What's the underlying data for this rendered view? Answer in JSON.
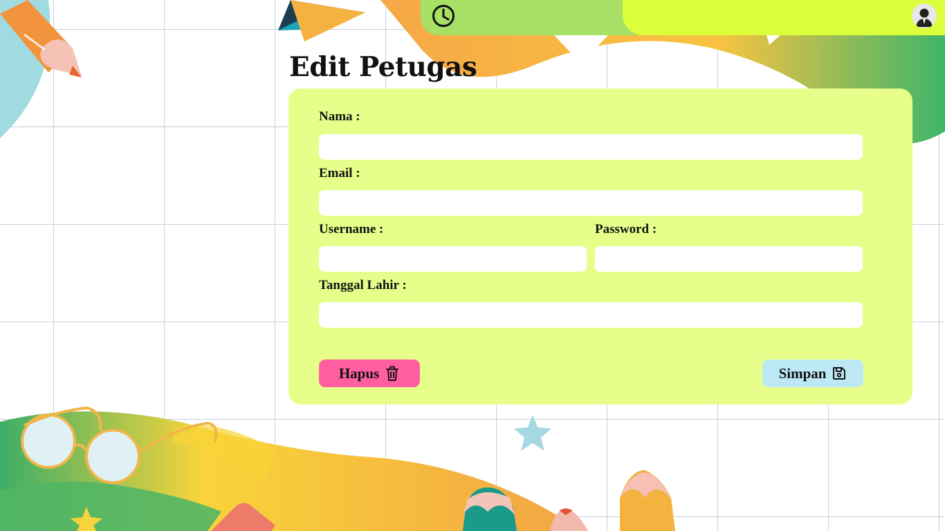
{
  "page": {
    "title": "Edit Petugas"
  },
  "topbar": {
    "clock_icon": "clock-icon",
    "avatar_icon": "user-avatar-icon"
  },
  "form": {
    "nama": {
      "label": "Nama :",
      "value": "",
      "placeholder": ""
    },
    "email": {
      "label": "Email :",
      "value": "",
      "placeholder": ""
    },
    "username": {
      "label": "Username :",
      "value": "",
      "placeholder": ""
    },
    "password": {
      "label": "Password :",
      "value": "",
      "placeholder": ""
    },
    "tanggal_lahir": {
      "label": "Tanggal Lahir :",
      "value": "",
      "placeholder": ""
    }
  },
  "actions": {
    "delete_label": "Hapus",
    "delete_icon": "trash-icon",
    "save_label": "Simpan",
    "save_icon": "floppy-disk-icon"
  },
  "colors": {
    "card_bg": "#e7ff8a",
    "topbar_green": "#a8e065",
    "topbar_yellow": "#dcff3b",
    "delete_button": "#ff5fa0",
    "save_button": "#bde9f7"
  }
}
